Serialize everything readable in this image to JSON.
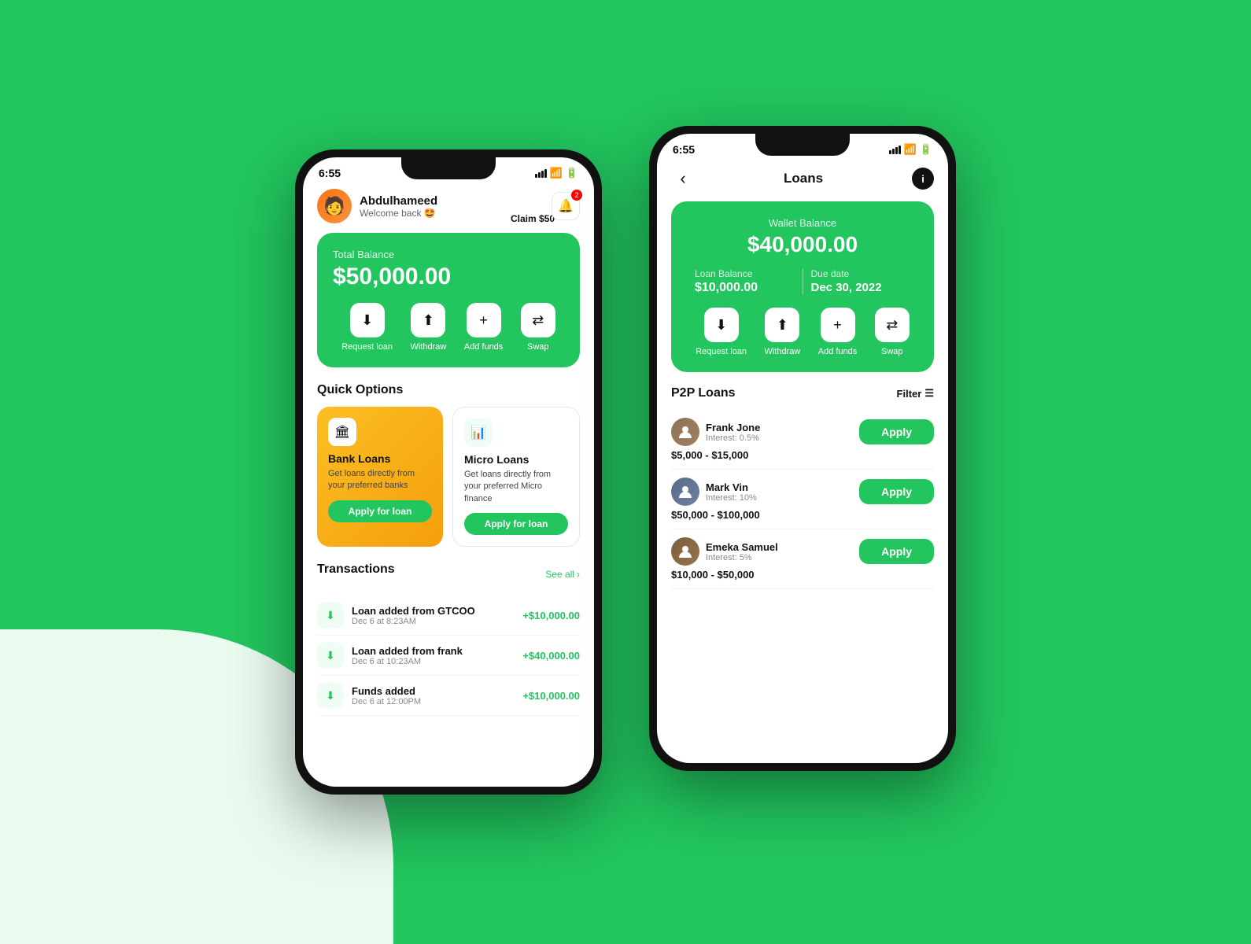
{
  "background": "#22c55e",
  "phone1": {
    "time": "6:55",
    "user": {
      "name": "Abdulhameed",
      "welcome": "Welcome back 🤩",
      "avatar_emoji": "🧑"
    },
    "notification_count": "2",
    "balance_card": {
      "label": "Total Balance",
      "amount": "$50,000.00",
      "claim_label": "Claim $50"
    },
    "actions": [
      {
        "icon": "⬇",
        "label": "Request loan"
      },
      {
        "icon": "⬆",
        "label": "Withdraw"
      },
      {
        "icon": "+",
        "label": "Add funds"
      },
      {
        "icon": "⇄",
        "label": "Swap"
      }
    ],
    "quick_options_title": "Quick Options",
    "options": [
      {
        "icon": "🏛",
        "title": "Bank Loans",
        "description": "Get loans directly from your preferred banks",
        "button_label": "Apply for loan",
        "style": "gold"
      },
      {
        "icon": "📊",
        "title": "Micro Loans",
        "description": "Get loans directly from your preferred Micro finance",
        "button_label": "Apply for loan",
        "style": "white"
      }
    ],
    "transactions_title": "Transactions",
    "see_all": "See all",
    "transactions": [
      {
        "icon": "⬇",
        "title": "Loan added from GTCOO",
        "date": "Dec 6 at 8:23AM",
        "amount": "+$10,000.00"
      },
      {
        "icon": "⬇",
        "title": "Loan added from frank",
        "date": "Dec 6 at 10:23AM",
        "amount": "+$40,000.00"
      },
      {
        "icon": "⬇",
        "title": "Funds added",
        "date": "Dec 6 at 12:00PM",
        "amount": "+$10,000.00"
      }
    ]
  },
  "phone2": {
    "time": "6:55",
    "back_icon": "‹",
    "title": "Loans",
    "info_icon": "ℹ",
    "wallet_card": {
      "label": "Wallet Balance",
      "amount": "$40,000.00",
      "loan_label": "Loan Balance",
      "loan_amount": "$10,000.00",
      "due_label": "Due date",
      "due_date": "Dec 30, 2022"
    },
    "actions": [
      {
        "icon": "⬇",
        "label": "Request loan"
      },
      {
        "icon": "⬆",
        "label": "Withdraw"
      },
      {
        "icon": "+",
        "label": "Add funds"
      },
      {
        "icon": "⇄",
        "label": "Swap"
      }
    ],
    "p2p_title": "P2P Loans",
    "filter_label": "Filter",
    "p2p_loans": [
      {
        "name": "Frank Jone",
        "interest": "Interest: 0.5%",
        "range": "$5,000 - $15,000",
        "apply_label": "Apply",
        "avatar_color": "#8b7355",
        "avatar_emoji": "👤"
      },
      {
        "name": "Mark Vin",
        "interest": "Interest: 10%",
        "range": "$50,000 - $100,000",
        "apply_label": "Apply",
        "avatar_color": "#5a6b8a",
        "avatar_emoji": "👤"
      },
      {
        "name": "Emeka Samuel",
        "interest": "Interest: 5%",
        "range": "$10,000 - $50,000",
        "apply_label": "Apply",
        "avatar_color": "#7a5c3a",
        "avatar_emoji": "👤"
      }
    ]
  }
}
